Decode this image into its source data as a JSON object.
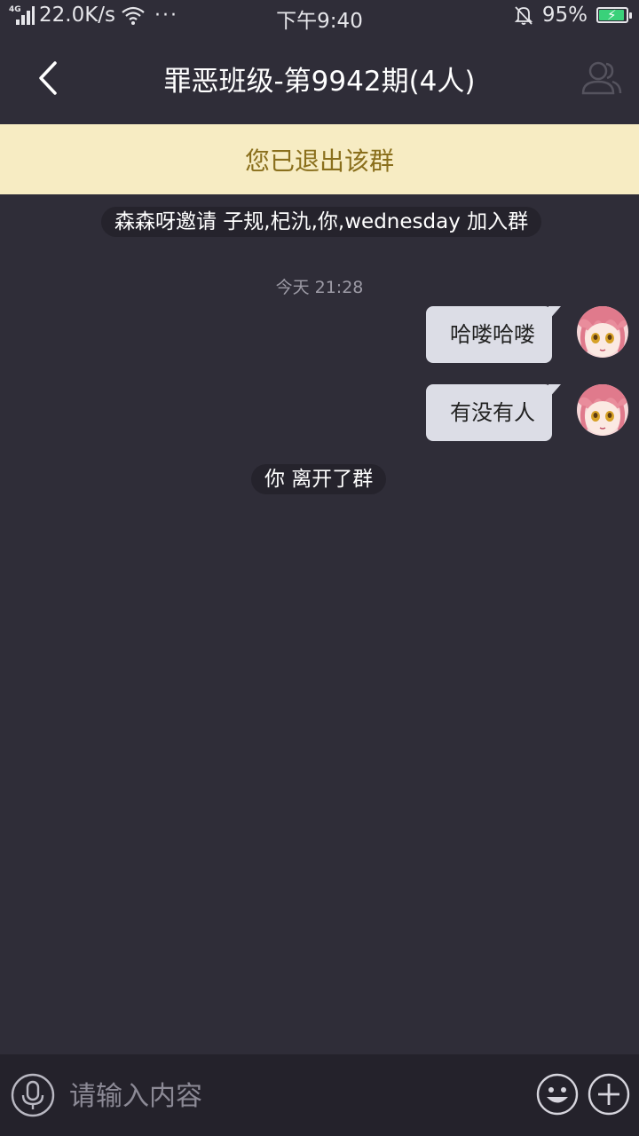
{
  "status_bar": {
    "network_type": "4G",
    "speed": "22.0K/s",
    "more": "···",
    "time": "下午9:40",
    "battery_percent": "95%",
    "battery_level": 0.95
  },
  "header": {
    "title": "罪恶班级-第9942期(4人)",
    "back_icon": "chevron-left-icon",
    "members_icon": "group-members-icon"
  },
  "notice": {
    "text": "您已退出该群"
  },
  "chat": {
    "invite_notice": "森森呀邀请 子规,杞氿,你,wednesday 加入群",
    "timestamp": "今天 21:28",
    "messages": [
      {
        "text": "哈喽哈喽",
        "from": "self"
      },
      {
        "text": "有没有人",
        "from": "self"
      }
    ],
    "leave_notice": "你 离开了群"
  },
  "input_bar": {
    "placeholder": "请输入内容",
    "voice_icon": "microphone-icon",
    "emoji_icon": "smiley-icon",
    "plus_icon": "plus-circle-icon"
  },
  "colors": {
    "background": "#2f2d38",
    "banner_background": "#f7ecc3",
    "banner_text": "#8a6f1c",
    "bubble": "#dcdde6",
    "battery_fill": "#3ad17a"
  }
}
